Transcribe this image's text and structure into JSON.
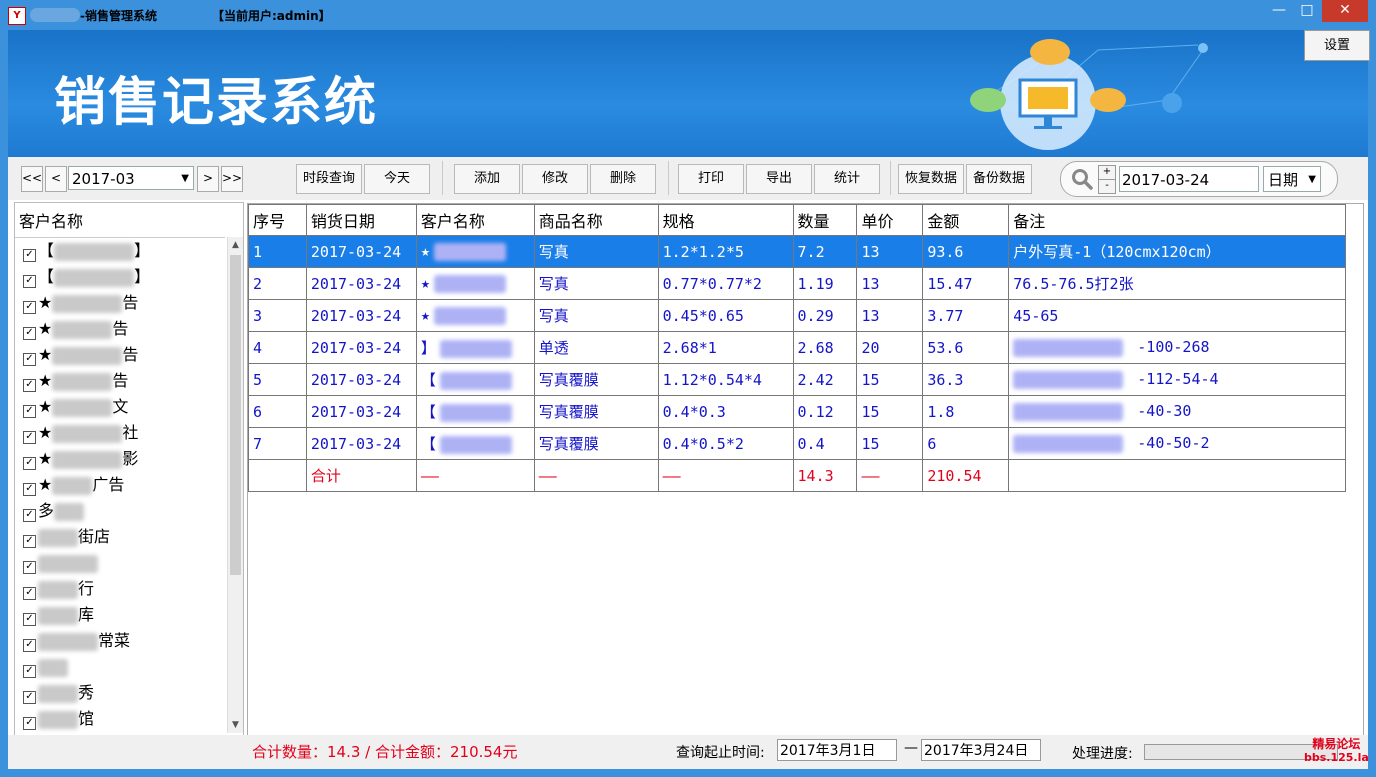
{
  "window": {
    "title": "-销售管理系统",
    "user_label": "【当前用户:admin】",
    "app_icon": "app-logo-icon",
    "controls": {
      "minimize": "—",
      "maximize": "□",
      "close": "✕"
    }
  },
  "banner": {
    "title": "销售记录系统",
    "settings_label": "设置"
  },
  "toolbar": {
    "first_label": "<<",
    "prev_label": "<",
    "month_value": "2017-03",
    "next_label": ">",
    "last_label": ">>",
    "range_query_label": "时段查询",
    "today_label": "今天",
    "add_label": "添加",
    "edit_label": "修改",
    "delete_label": "删除",
    "print_label": "打印",
    "export_label": "导出",
    "stats_label": "统计",
    "restore_label": "恢复数据",
    "backup_label": "备份数据",
    "search_date": "2017-03-24",
    "search_type": "日期",
    "spin_up": "+",
    "spin_down": "-"
  },
  "customer_panel": {
    "header": "客户名称",
    "items": [
      {
        "prefix": "【",
        "suffix": "】"
      },
      {
        "prefix": "【",
        "suffix": "】"
      },
      {
        "prefix": "★",
        "suffix": "告"
      },
      {
        "prefix": "★",
        "suffix": "告"
      },
      {
        "prefix": "★",
        "suffix": "告"
      },
      {
        "prefix": "★",
        "suffix": "告"
      },
      {
        "prefix": "★",
        "suffix": "文"
      },
      {
        "prefix": "★",
        "suffix": "社"
      },
      {
        "prefix": "★",
        "suffix": "影"
      },
      {
        "prefix": "★",
        "suffix": "广告"
      },
      {
        "prefix": "多",
        "suffix": ""
      },
      {
        "prefix": "",
        "suffix": "街店"
      },
      {
        "prefix": "",
        "suffix": ""
      },
      {
        "prefix": "",
        "suffix": "行"
      },
      {
        "prefix": "",
        "suffix": "库"
      },
      {
        "prefix": "",
        "suffix": "常菜"
      },
      {
        "prefix": "",
        "suffix": ""
      },
      {
        "prefix": "",
        "suffix": "秀"
      },
      {
        "prefix": "",
        "suffix": "馆"
      }
    ]
  },
  "grid": {
    "columns": [
      "序号",
      "销货日期",
      "客户名称",
      "商品名称",
      "规格",
      "数量",
      "单价",
      "金额",
      "备注"
    ],
    "rows": [
      {
        "no": "1",
        "date": "2017-03-24",
        "customer": "★",
        "product": "写真",
        "spec": "1.2*1.2*5",
        "qty": "7.2",
        "price": "13",
        "amount": "93.6",
        "note": "户外写真-1（120cmx120cm）"
      },
      {
        "no": "2",
        "date": "2017-03-24",
        "customer": "★",
        "product": "写真",
        "spec": "0.77*0.77*2",
        "qty": "1.19",
        "price": "13",
        "amount": "15.47",
        "note": "76.5-76.5打2张"
      },
      {
        "no": "3",
        "date": "2017-03-24",
        "customer": "★",
        "product": "写真",
        "spec": "0.45*0.65",
        "qty": "0.29",
        "price": "13",
        "amount": "3.77",
        "note": "45-65"
      },
      {
        "no": "4",
        "date": "2017-03-24",
        "customer": "】",
        "product": "单透",
        "spec": "2.68*1",
        "qty": "2.68",
        "price": "20",
        "amount": "53.6",
        "note": "-100-268"
      },
      {
        "no": "5",
        "date": "2017-03-24",
        "customer": "【",
        "product": "写真覆膜",
        "spec": "1.12*0.54*4",
        "qty": "2.42",
        "price": "15",
        "amount": "36.3",
        "note": "-112-54-4"
      },
      {
        "no": "6",
        "date": "2017-03-24",
        "customer": "【",
        "product": "写真覆膜",
        "spec": "0.4*0.3",
        "qty": "0.12",
        "price": "15",
        "amount": "1.8",
        "note": "-40-30"
      },
      {
        "no": "7",
        "date": "2017-03-24",
        "customer": "【",
        "product": "写真覆膜",
        "spec": "0.4*0.5*2",
        "qty": "0.4",
        "price": "15",
        "amount": "6",
        "note": "-40-50-2"
      }
    ],
    "total": {
      "label": "合计",
      "dash": "——",
      "qty": "14.3",
      "amount": "210.54"
    }
  },
  "statusbar": {
    "total_text": "合计数量：14.3 / 合计金额：210.54元",
    "query_label": "查询起止时间:",
    "start_date": "2017年3月1日",
    "dash": "—",
    "end_date": "2017年3月24日",
    "progress_label": "处理进度:",
    "watermark_line1": "精易论坛",
    "watermark_line2": "bbs.125.la"
  },
  "colors": {
    "title_blue": "#3b91dc",
    "banner_blue": "#1e7ad0",
    "selected_row": "#1a7ee8",
    "cell_text": "#1414c8",
    "total_red": "#e3001b"
  }
}
